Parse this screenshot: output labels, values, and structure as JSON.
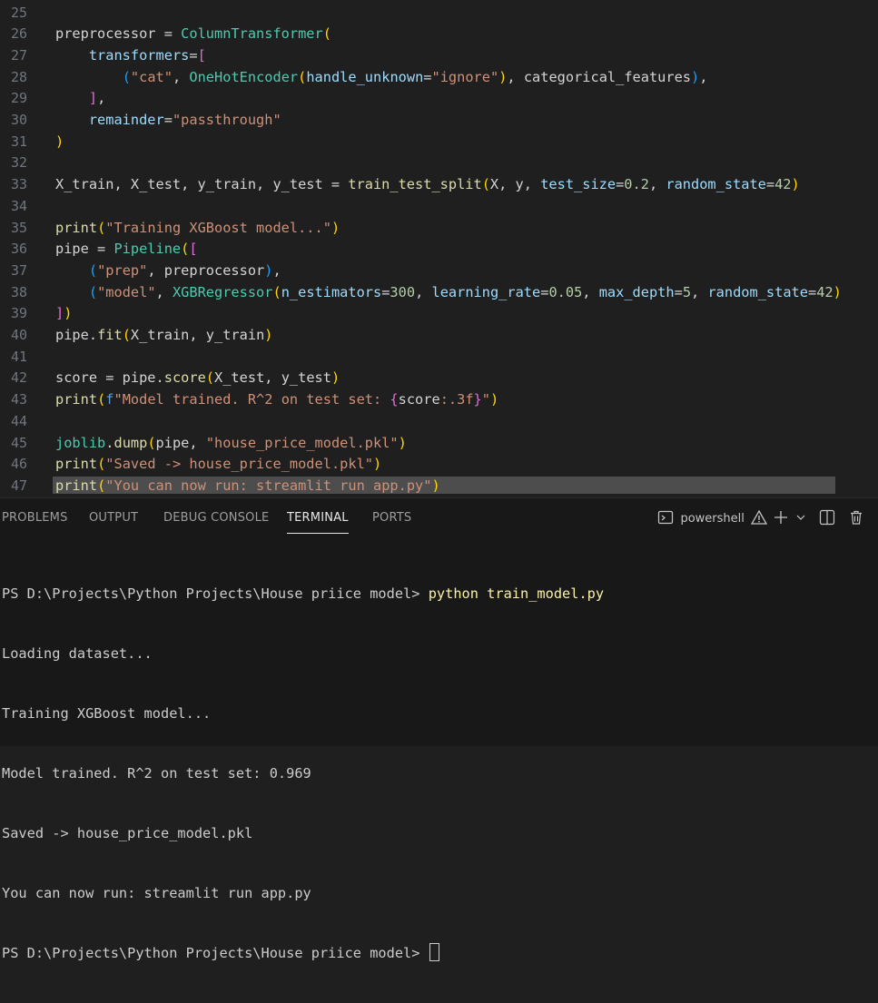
{
  "editor": {
    "lines": [
      {
        "n": "25",
        "tokens": []
      },
      {
        "n": "26",
        "tokens": [
          [
            "preprocessor = ",
            "plain"
          ],
          [
            "ColumnTransformer",
            "cls"
          ],
          [
            "(",
            "b1"
          ]
        ]
      },
      {
        "n": "27",
        "tokens": [
          [
            "    ",
            "plain"
          ],
          [
            "transformers",
            "param"
          ],
          [
            "=",
            "plain"
          ],
          [
            "[",
            "b2"
          ]
        ]
      },
      {
        "n": "28",
        "tokens": [
          [
            "        ",
            "plain"
          ],
          [
            "(",
            "b3"
          ],
          [
            "\"cat\"",
            "str"
          ],
          [
            ", ",
            "plain"
          ],
          [
            "OneHotEncoder",
            "cls"
          ],
          [
            "(",
            "b1"
          ],
          [
            "handle_unknown",
            "param"
          ],
          [
            "=",
            "plain"
          ],
          [
            "\"ignore\"",
            "str"
          ],
          [
            ")",
            "b1"
          ],
          [
            ", categorical_features",
            "plain"
          ],
          [
            ")",
            "b3"
          ],
          [
            ",",
            "plain"
          ]
        ]
      },
      {
        "n": "29",
        "tokens": [
          [
            "    ",
            "plain"
          ],
          [
            "]",
            "b2"
          ],
          [
            ",",
            "plain"
          ]
        ]
      },
      {
        "n": "30",
        "tokens": [
          [
            "    ",
            "plain"
          ],
          [
            "remainder",
            "param"
          ],
          [
            "=",
            "plain"
          ],
          [
            "\"passthrough\"",
            "str"
          ]
        ]
      },
      {
        "n": "31",
        "tokens": [
          [
            ")",
            "b1"
          ]
        ]
      },
      {
        "n": "32",
        "tokens": []
      },
      {
        "n": "33",
        "tokens": [
          [
            "X_train, X_test, y_train, y_test = ",
            "plain"
          ],
          [
            "train_test_split",
            "fn"
          ],
          [
            "(",
            "b1"
          ],
          [
            "X, y, ",
            "plain"
          ],
          [
            "test_size",
            "param"
          ],
          [
            "=",
            "plain"
          ],
          [
            "0.2",
            "num"
          ],
          [
            ", ",
            "plain"
          ],
          [
            "random_state",
            "param"
          ],
          [
            "=",
            "plain"
          ],
          [
            "42",
            "num"
          ],
          [
            ")",
            "b1"
          ]
        ]
      },
      {
        "n": "34",
        "tokens": []
      },
      {
        "n": "35",
        "tokens": [
          [
            "print",
            "fn"
          ],
          [
            "(",
            "b1"
          ],
          [
            "\"Training XGBoost model...\"",
            "str"
          ],
          [
            ")",
            "b1"
          ]
        ]
      },
      {
        "n": "36",
        "tokens": [
          [
            "pipe = ",
            "plain"
          ],
          [
            "Pipeline",
            "cls"
          ],
          [
            "(",
            "b1"
          ],
          [
            "[",
            "b2"
          ]
        ]
      },
      {
        "n": "37",
        "tokens": [
          [
            "    ",
            "plain"
          ],
          [
            "(",
            "b3"
          ],
          [
            "\"prep\"",
            "str"
          ],
          [
            ", preprocessor",
            "plain"
          ],
          [
            ")",
            "b3"
          ],
          [
            ",",
            "plain"
          ]
        ]
      },
      {
        "n": "38",
        "tokens": [
          [
            "    ",
            "plain"
          ],
          [
            "(",
            "b3"
          ],
          [
            "\"model\"",
            "str"
          ],
          [
            ", ",
            "plain"
          ],
          [
            "XGBRegressor",
            "cls"
          ],
          [
            "(",
            "b1"
          ],
          [
            "n_estimators",
            "param"
          ],
          [
            "=",
            "plain"
          ],
          [
            "300",
            "num"
          ],
          [
            ", ",
            "plain"
          ],
          [
            "learning_rate",
            "param"
          ],
          [
            "=",
            "plain"
          ],
          [
            "0.05",
            "num"
          ],
          [
            ", ",
            "plain"
          ],
          [
            "max_depth",
            "param"
          ],
          [
            "=",
            "plain"
          ],
          [
            "5",
            "num"
          ],
          [
            ", ",
            "plain"
          ],
          [
            "random_state",
            "param"
          ],
          [
            "=",
            "plain"
          ],
          [
            "42",
            "num"
          ],
          [
            ")",
            "b1"
          ]
        ]
      },
      {
        "n": "39",
        "tokens": [
          [
            "]",
            "b2"
          ],
          [
            ")",
            "b1"
          ]
        ]
      },
      {
        "n": "40",
        "tokens": [
          [
            "pipe.",
            "plain"
          ],
          [
            "fit",
            "fn"
          ],
          [
            "(",
            "b1"
          ],
          [
            "X_train, y_train",
            "plain"
          ],
          [
            ")",
            "b1"
          ]
        ]
      },
      {
        "n": "41",
        "tokens": []
      },
      {
        "n": "42",
        "tokens": [
          [
            "score = pipe.",
            "plain"
          ],
          [
            "score",
            "fn"
          ],
          [
            "(",
            "b1"
          ],
          [
            "X_test, y_test",
            "plain"
          ],
          [
            ")",
            "b1"
          ]
        ]
      },
      {
        "n": "43",
        "tokens": [
          [
            "print",
            "fn"
          ],
          [
            "(",
            "b1"
          ],
          [
            "f",
            "fstr"
          ],
          [
            "\"Model trained. R^2 on test set: ",
            "str"
          ],
          [
            "{",
            "b2"
          ],
          [
            "score",
            "plain"
          ],
          [
            ":.3f",
            "str"
          ],
          [
            "}",
            "b2"
          ],
          [
            "\"",
            "str"
          ],
          [
            ")",
            "b1"
          ]
        ]
      },
      {
        "n": "44",
        "tokens": []
      },
      {
        "n": "45",
        "tokens": [
          [
            "joblib",
            "cls"
          ],
          [
            ".",
            "plain"
          ],
          [
            "dump",
            "fn"
          ],
          [
            "(",
            "b1"
          ],
          [
            "pipe, ",
            "plain"
          ],
          [
            "\"house_price_model.pkl\"",
            "str"
          ],
          [
            ")",
            "b1"
          ]
        ]
      },
      {
        "n": "46",
        "tokens": [
          [
            "print",
            "fn"
          ],
          [
            "(",
            "b1"
          ],
          [
            "\"Saved -> house_price_model.pkl\"",
            "str"
          ],
          [
            ")",
            "b1"
          ]
        ]
      },
      {
        "n": "47",
        "tokens": [
          [
            "print",
            "fn"
          ],
          [
            "(",
            "b1"
          ],
          [
            "\"You can now run: streamlit run app.py\"",
            "str"
          ],
          [
            ")",
            "b1"
          ]
        ],
        "highlight": true
      }
    ]
  },
  "panel": {
    "tabs": {
      "problems": "PROBLEMS",
      "output": "OUTPUT",
      "debug_console": "DEBUG CONSOLE",
      "terminal": "TERMINAL",
      "ports": "PORTS"
    },
    "active_tab": "TERMINAL",
    "toolbar": {
      "shell_name": "powershell"
    }
  },
  "terminal": {
    "prompt": "PS D:\\Projects\\Python Projects\\House priice model> ",
    "command": "python train_model.py",
    "output_lines": [
      "Loading dataset...",
      "Training XGBoost model...",
      "Model trained. R^2 on test set: 0.969",
      "Saved -> house_price_model.pkl",
      "You can now run: streamlit run app.py"
    ],
    "final_prompt": "PS D:\\Projects\\Python Projects\\House priice model>"
  },
  "colors": {
    "editor_bg": "#1f1f1f",
    "panel_bg": "#181818",
    "command": "#f9f1a5",
    "warning": "#cca700"
  }
}
